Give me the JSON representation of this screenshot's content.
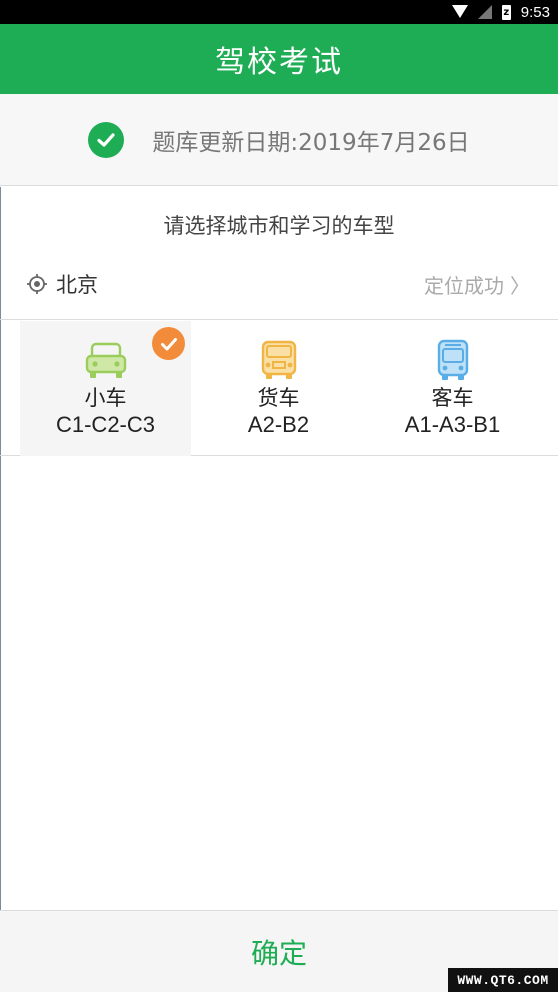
{
  "status_bar": {
    "time": "9:53",
    "battery_glyph": "z"
  },
  "app_bar": {
    "title": "驾校考试"
  },
  "update_banner": {
    "text": "题库更新日期:2019年7月26日",
    "icon": "check-circle-icon",
    "accent": "#1ead54"
  },
  "prompt": {
    "text": "请选择城市和学习的车型"
  },
  "city_row": {
    "city": "北京",
    "status": "定位成功",
    "chevron": "〉"
  },
  "vehicles": [
    {
      "name": "小车",
      "code": "C1-C2-C3",
      "icon": "car-icon",
      "color": "#9acd5a",
      "selected": true
    },
    {
      "name": "货车",
      "code": "A2-B2",
      "icon": "truck-icon",
      "color": "#f0b545",
      "selected": false
    },
    {
      "name": "客车",
      "code": "A1-A3-B1",
      "icon": "bus-icon",
      "color": "#5aaee8",
      "selected": false
    }
  ],
  "selected_badge_color": "#f38c3a",
  "bottom": {
    "confirm_label": "确定"
  },
  "watermark": {
    "text": "WWW.QT6.COM"
  }
}
